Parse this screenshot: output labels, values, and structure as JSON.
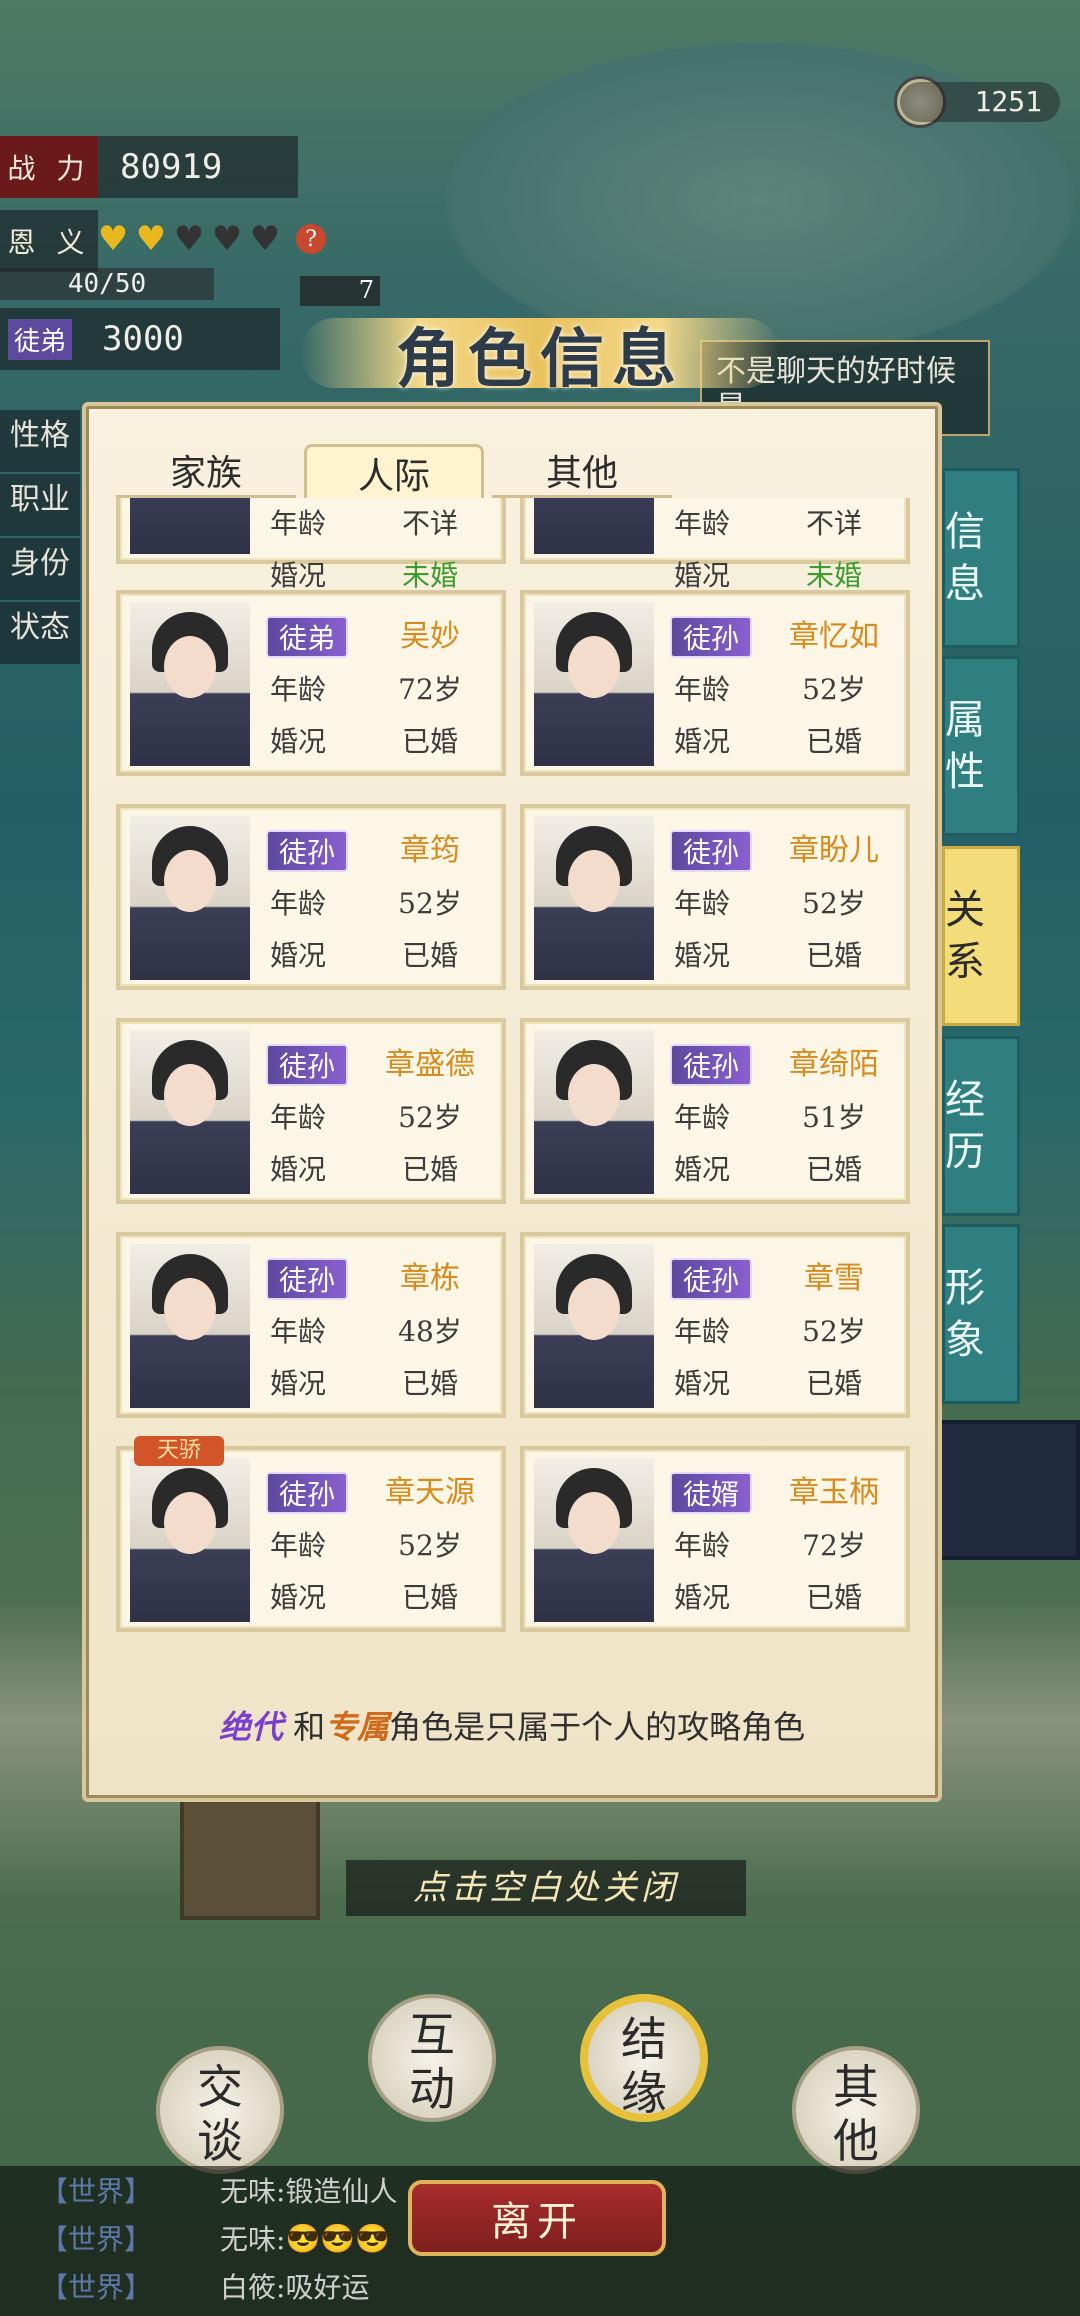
{
  "top": {
    "coins": "1251",
    "power_label": "战 力",
    "power_value": "80919",
    "favor_label": "恩 义",
    "favor_hearts": [
      "gold",
      "gold",
      "dark",
      "dark",
      "dark"
    ],
    "favor_progress_text": "40/50",
    "favor_progress_fraction": 0.8,
    "small_count": "7",
    "relation_badge": "徒弟",
    "relation_value": "3000",
    "side_labels": [
      "性格",
      "职业",
      "身份",
      "状态"
    ],
    "speech_text": "不是聊天的好时候 是"
  },
  "modal": {
    "title": "角色信息",
    "tabs": [
      "家族",
      "人际",
      "其他"
    ],
    "active_tab": "人际",
    "side_tabs": [
      "信息",
      "属性",
      "关系",
      "经历",
      "形象"
    ],
    "active_side_tab": "关系",
    "age_label": "年龄",
    "marriage_label": "婚况",
    "cards": [
      {
        "badge": "",
        "name": "",
        "age": "不详",
        "marriage": "未婚"
      },
      {
        "badge": "",
        "name": "",
        "age": "不详",
        "marriage": "未婚"
      },
      {
        "badge": "徒弟",
        "name": "吴妙",
        "age": "72岁",
        "marriage": "已婚"
      },
      {
        "badge": "徒孙",
        "name": "章忆如",
        "age": "52岁",
        "marriage": "已婚"
      },
      {
        "badge": "徒孙",
        "name": "章筠",
        "age": "52岁",
        "marriage": "已婚"
      },
      {
        "badge": "徒孙",
        "name": "章盼儿",
        "age": "52岁",
        "marriage": "已婚"
      },
      {
        "badge": "徒孙",
        "name": "章盛德",
        "age": "52岁",
        "marriage": "已婚"
      },
      {
        "badge": "徒孙",
        "name": "章绮陌",
        "age": "51岁",
        "marriage": "已婚"
      },
      {
        "badge": "徒孙",
        "name": "章栋",
        "age": "48岁",
        "marriage": "已婚"
      },
      {
        "badge": "徒孙",
        "name": "章雪",
        "age": "52岁",
        "marriage": "已婚"
      },
      {
        "badge": "徒孙",
        "name": "章天源",
        "age": "52岁",
        "marriage": "已婚",
        "crown": "天骄"
      },
      {
        "badge": "徒婿",
        "name": "章玉柄",
        "age": "72岁",
        "marriage": "已婚"
      }
    ],
    "note_part1": "绝代",
    "note_and": "和",
    "note_part2": "专属",
    "note_rest": "角色是只属于个人的攻略角色",
    "close_hint": "点击空白处关闭"
  },
  "buttons": {
    "chat": "交谈",
    "interact": "互动",
    "bond": "结缘",
    "other": "其他",
    "leave": "离开"
  },
  "chat": [
    {
      "channel": "【世界】",
      "user": "无味:",
      "msg": "锻造仙人"
    },
    {
      "channel": "【世界】",
      "user": "无味:",
      "msg": "😎😎😎"
    },
    {
      "channel": "【世界】",
      "user": "白筱:",
      "msg": "吸好运"
    }
  ],
  "colors": {
    "accent": "#e7c13a",
    "badge": "#7a55c4",
    "name": "#d88a1c",
    "leave": "#a92c2c",
    "teal": "#2f7f80"
  }
}
